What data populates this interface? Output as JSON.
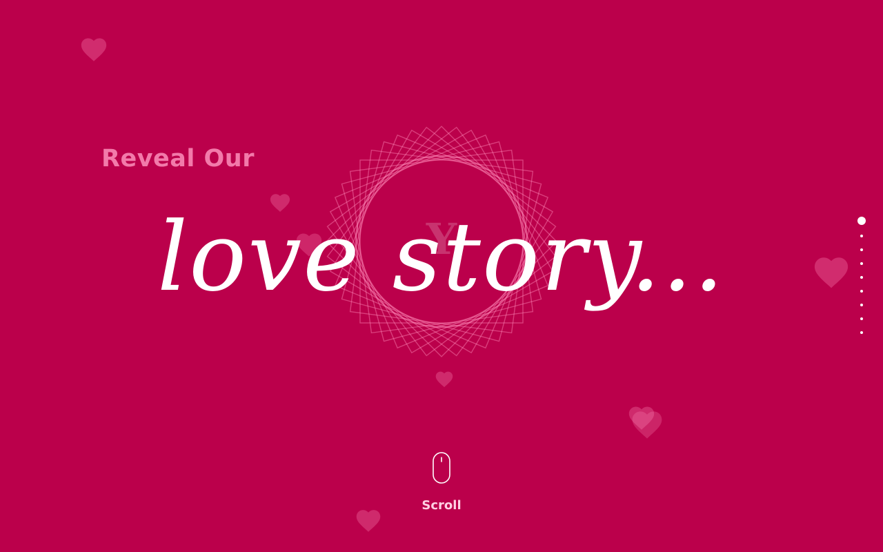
{
  "theme": {
    "background": "#bb004b",
    "heart_color": "#ff8ab9",
    "emblem_color": "#ff8ab9",
    "kicker_color": "#f27aaa",
    "headline_color": "#ffffff",
    "scroll_color": "#ffd1e3"
  },
  "hero": {
    "kicker": "Reveal Our",
    "headline": "love story...",
    "emblem_letter": "Y",
    "emblem_icon": "spirograph-ring-emblem"
  },
  "pager": {
    "active_index": 0,
    "count": 9
  },
  "scroll": {
    "label": "Scroll",
    "icon": "mouse-icon"
  },
  "decor": {
    "icon": "heart-icon"
  }
}
